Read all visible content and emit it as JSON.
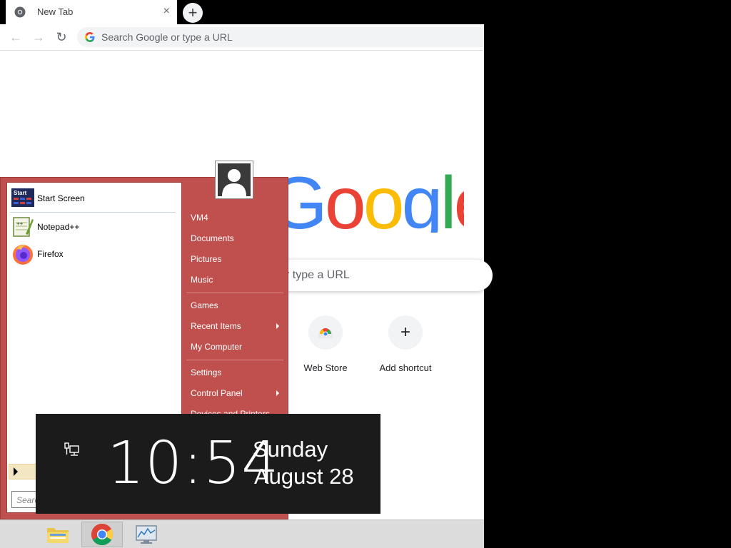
{
  "browser": {
    "tab": {
      "title": "New Tab",
      "close_glyph": "×"
    },
    "new_tab_glyph": "+",
    "nav": {
      "back_glyph": "←",
      "forward_glyph": "→",
      "reload_glyph": "↻"
    },
    "omnibox": {
      "placeholder": "Search Google or type a URL"
    }
  },
  "ntp": {
    "logo_text": "Google",
    "search_visible_text": "r type a URL",
    "shortcuts": [
      {
        "label": "Web Store",
        "icon": "web-store-icon"
      },
      {
        "label": "Add shortcut",
        "icon": "plus-icon",
        "glyph": "+"
      }
    ]
  },
  "start_menu": {
    "programs": [
      {
        "label": "Start Screen",
        "icon": "start-screen-icon",
        "icon_text": "Start"
      },
      {
        "label": "Notepad++",
        "icon": "notepad-plus-plus-icon"
      },
      {
        "label": "Firefox",
        "icon": "firefox-icon"
      }
    ],
    "search_placeholder": "Searc",
    "right_links": [
      {
        "label": "VM4"
      },
      {
        "label": "Documents"
      },
      {
        "label": "Pictures"
      },
      {
        "label": "Music"
      },
      {
        "label": "Games"
      },
      {
        "label": "Recent Items",
        "submenu": true
      },
      {
        "label": "My Computer"
      },
      {
        "label": "Settings"
      },
      {
        "label": "Control Panel",
        "submenu": true
      },
      {
        "label": "Devices and Printers"
      }
    ]
  },
  "clock": {
    "time": "10:54",
    "day": "Sunday",
    "date": "August 28"
  },
  "taskbar": {
    "items": [
      {
        "icon": "file-explorer-icon"
      },
      {
        "icon": "chrome-icon",
        "active": true
      },
      {
        "icon": "task-manager-icon"
      }
    ]
  },
  "colors": {
    "start_menu_bg": "#c0504d",
    "google_blue": "#4285f4",
    "google_red": "#ea4335",
    "google_yellow": "#fbbc05",
    "google_green": "#34a853"
  }
}
